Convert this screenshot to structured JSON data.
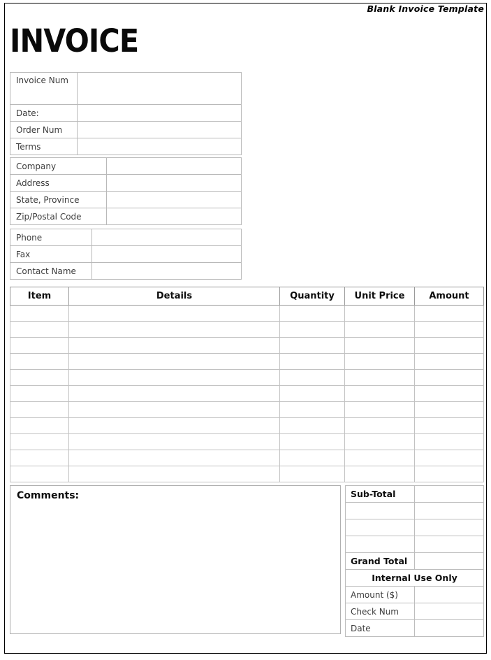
{
  "document": {
    "header_label": "Blank Invoice Template",
    "title": "INVOICE"
  },
  "invoice_meta": {
    "rows": [
      {
        "label": "Invoice Num",
        "value": ""
      },
      {
        "label": "Date:",
        "value": ""
      },
      {
        "label": "Order Num",
        "value": ""
      },
      {
        "label": "Terms",
        "value": ""
      }
    ]
  },
  "company_block": {
    "rows": [
      {
        "label": "Company",
        "value": ""
      },
      {
        "label": "Address",
        "value": ""
      },
      {
        "label": "State, Province",
        "value": ""
      },
      {
        "label": "Zip/Postal Code",
        "value": ""
      }
    ]
  },
  "contact_block": {
    "rows": [
      {
        "label": "Phone",
        "value": ""
      },
      {
        "label": "Fax",
        "value": ""
      },
      {
        "label": "Contact Name",
        "value": ""
      }
    ]
  },
  "items_table": {
    "columns": [
      "Item",
      "Details",
      "Quantity",
      "Unit Price",
      "Amount"
    ],
    "row_count": 11,
    "rows": [
      {
        "item": "",
        "details": "",
        "quantity": "",
        "unit_price": "",
        "amount": ""
      },
      {
        "item": "",
        "details": "",
        "quantity": "",
        "unit_price": "",
        "amount": ""
      },
      {
        "item": "",
        "details": "",
        "quantity": "",
        "unit_price": "",
        "amount": ""
      },
      {
        "item": "",
        "details": "",
        "quantity": "",
        "unit_price": "",
        "amount": ""
      },
      {
        "item": "",
        "details": "",
        "quantity": "",
        "unit_price": "",
        "amount": ""
      },
      {
        "item": "",
        "details": "",
        "quantity": "",
        "unit_price": "",
        "amount": ""
      },
      {
        "item": "",
        "details": "",
        "quantity": "",
        "unit_price": "",
        "amount": ""
      },
      {
        "item": "",
        "details": "",
        "quantity": "",
        "unit_price": "",
        "amount": ""
      },
      {
        "item": "",
        "details": "",
        "quantity": "",
        "unit_price": "",
        "amount": ""
      },
      {
        "item": "",
        "details": "",
        "quantity": "",
        "unit_price": "",
        "amount": ""
      },
      {
        "item": "",
        "details": "",
        "quantity": "",
        "unit_price": "",
        "amount": ""
      }
    ]
  },
  "comments": {
    "label": "Comments:",
    "value": ""
  },
  "totals": {
    "rows": [
      {
        "label": "Sub-Total",
        "value": "",
        "emphasis": "bold"
      },
      {
        "label": "",
        "value": "",
        "emphasis": "none"
      },
      {
        "label": "",
        "value": "",
        "emphasis": "none"
      },
      {
        "label": "",
        "value": "",
        "emphasis": "none"
      },
      {
        "label": "Grand Total",
        "value": "",
        "emphasis": "bold"
      }
    ],
    "internal_section_label": "Internal Use Only",
    "internal_rows": [
      {
        "label": "Amount ($)",
        "value": ""
      },
      {
        "label": "Check Num",
        "value": ""
      },
      {
        "label": "Date",
        "value": ""
      }
    ]
  },
  "colors": {
    "page_border": "#000000",
    "grid_line": "#bdbdbd",
    "header_line": "#9a9a9a",
    "text": "#3c3c3c",
    "heading_text": "#0d0d0d"
  }
}
